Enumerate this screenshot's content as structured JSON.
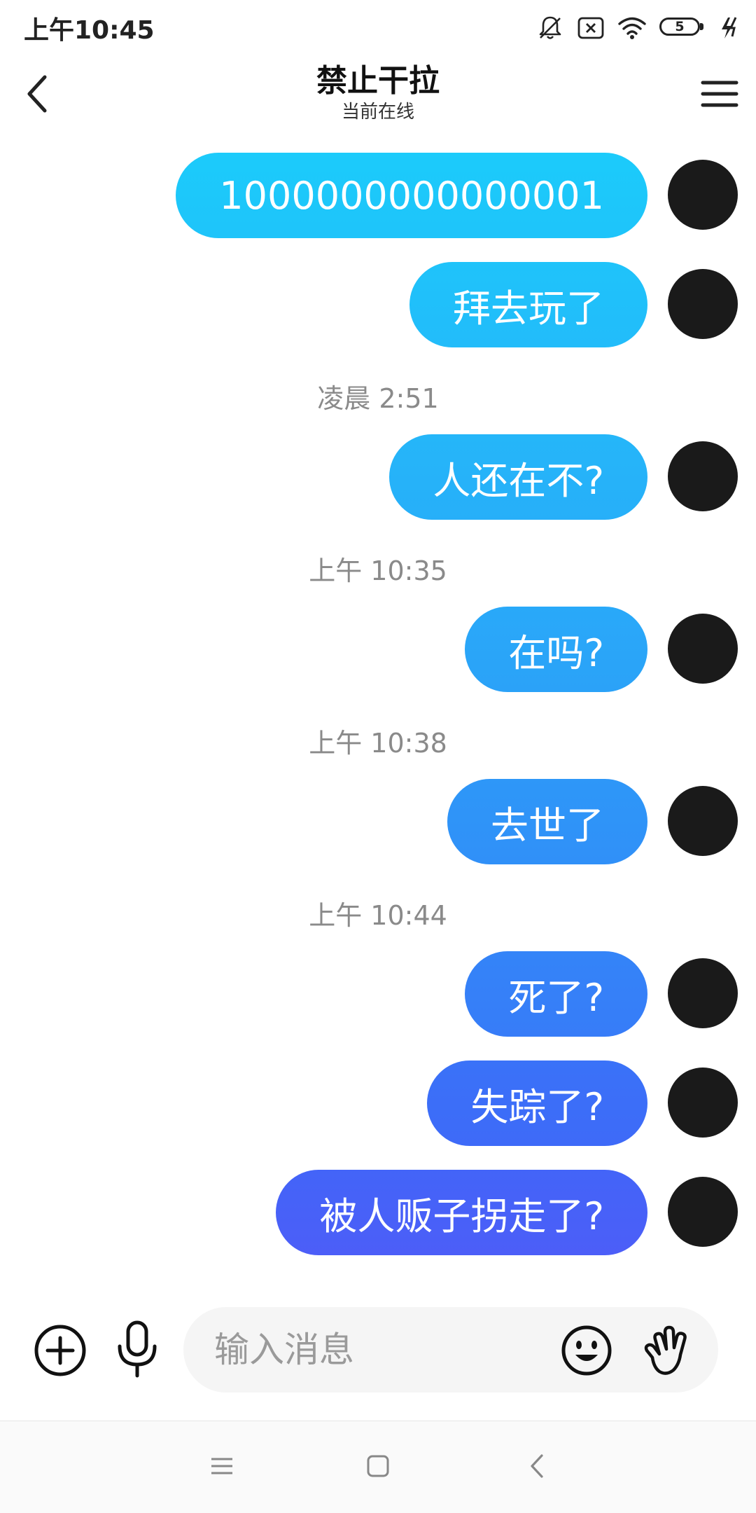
{
  "status_bar": {
    "time": "上午10:45",
    "battery_level": "5",
    "icons": [
      "bell-off-icon",
      "sim-error-icon",
      "wifi-icon",
      "battery-icon",
      "charging-icon"
    ]
  },
  "header": {
    "title": "禁止干拉",
    "subtitle": "当前在线",
    "back_icon": "chevron-left-icon",
    "menu_icon": "hamburger-menu-icon"
  },
  "colors": {
    "bubble_gradient_top": "#1ccbfb",
    "bubble_gradient_bottom": "#4c5ef8",
    "timestamp_text": "#8a8a8a",
    "input_background": "#f5f5f5"
  },
  "messages": [
    {
      "type": "message",
      "text": "1000000000000001"
    },
    {
      "type": "message",
      "text": "拜去玩了"
    },
    {
      "type": "timestamp",
      "text": "凌晨 2:51"
    },
    {
      "type": "message",
      "text": "人还在不?"
    },
    {
      "type": "timestamp",
      "text": "上午 10:35"
    },
    {
      "type": "message",
      "text": "在吗?"
    },
    {
      "type": "timestamp",
      "text": "上午 10:38"
    },
    {
      "type": "message",
      "text": "去世了"
    },
    {
      "type": "timestamp",
      "text": "上午 10:44"
    },
    {
      "type": "message",
      "text": "死了?"
    },
    {
      "type": "message",
      "text": "失踪了?"
    },
    {
      "type": "message",
      "text": "被人贩子拐走了?"
    }
  ],
  "input_bar": {
    "placeholder": "输入消息",
    "icons": [
      "plus-circle-icon",
      "microphone-icon",
      "emoji-icon",
      "wave-hand-icon"
    ]
  },
  "nav_bar": {
    "icons": [
      "recent-apps-icon",
      "home-icon",
      "back-icon"
    ]
  }
}
